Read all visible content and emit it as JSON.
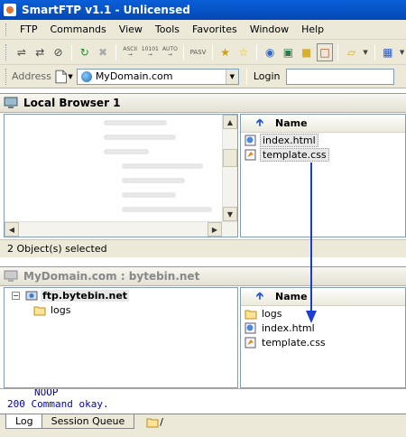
{
  "window": {
    "title": "SmartFTP v1.1 - Unlicensed"
  },
  "menu": {
    "items": [
      "FTP",
      "Commands",
      "View",
      "Tools",
      "Favorites",
      "Window",
      "Help"
    ]
  },
  "toolbar": {
    "ascii_label": "ASCII",
    "binary_label": "10101",
    "auto_label": "AUTO",
    "pasv_label": "PASV"
  },
  "address": {
    "label": "Address",
    "value": "MyDomain.com",
    "login_label": "Login",
    "login_value": ""
  },
  "local": {
    "title": "Local Browser 1",
    "column_name": "Name",
    "files": [
      "index.html",
      "template.css"
    ],
    "status": "2 Object(s) selected"
  },
  "remote": {
    "title": "MyDomain.com : bytebin.net",
    "tree_root": "ftp.bytebin.net",
    "tree_child": "logs",
    "column_name": "Name",
    "files": [
      "logs",
      "index.html",
      "template.css"
    ]
  },
  "log": {
    "lines": [
      "NOOP",
      "200 Command okay."
    ]
  },
  "tabs": {
    "log": "Log",
    "queue": "Session Queue",
    "path": "/"
  },
  "colors": {
    "titlebar": "#0a5fd8",
    "arrow": "#1a3fd0",
    "log_text": "#0000c0"
  }
}
